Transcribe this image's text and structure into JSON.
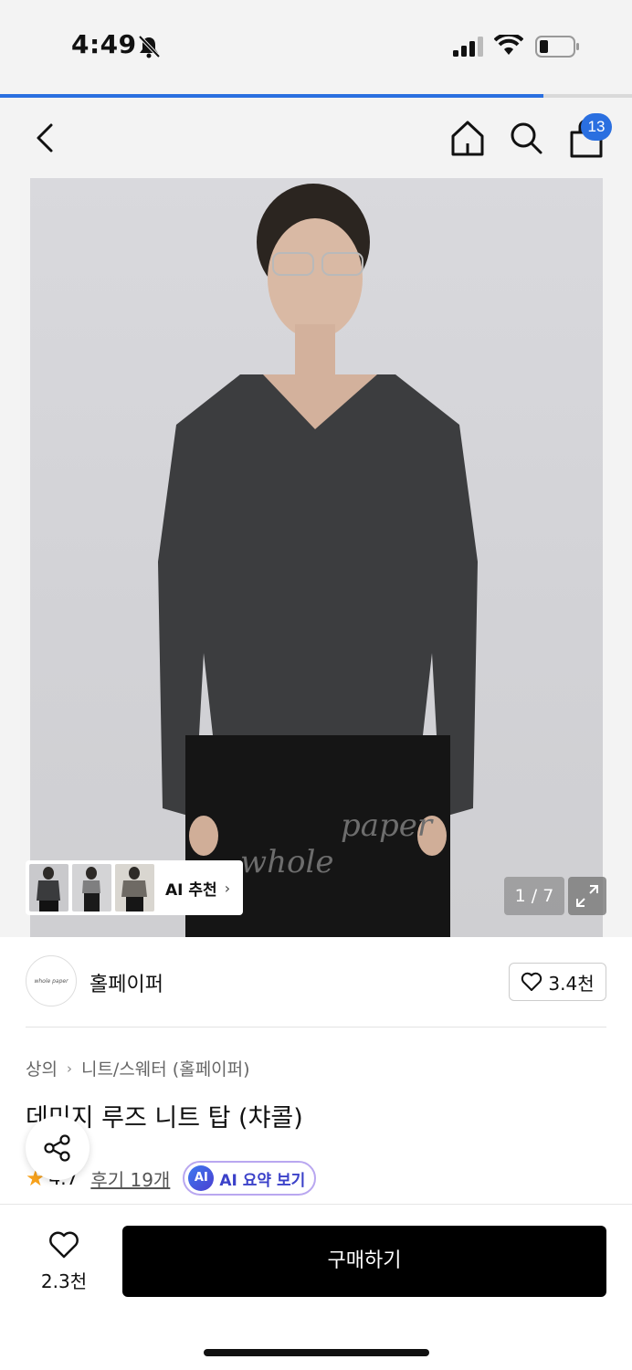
{
  "status_bar": {
    "time": "4:49",
    "icons": [
      "bell-off-icon",
      "signal-icon",
      "wifi-icon",
      "battery-icon"
    ]
  },
  "page_progress": {
    "fraction": 0.86,
    "color": "#2a6fe0"
  },
  "nav": {
    "cart_badge": "13",
    "icons": [
      "back-chevron-icon",
      "home-icon",
      "search-icon",
      "shopping-bag-icon"
    ]
  },
  "hero": {
    "thumb_strip_label": "AI 추천",
    "counter": "1 / 7",
    "icons": [
      "chevron-right-icon",
      "expand-icon"
    ]
  },
  "brand": {
    "name": "홀페이퍼",
    "likes": "3.4천"
  },
  "breadcrumb": {
    "category": "상의",
    "subcategory": "니트/스웨터 (홀페이퍼)"
  },
  "product": {
    "title": "데미지 루즈 니트 탑 (챠콜)"
  },
  "rating": {
    "value": "4.7",
    "reviews": "후기 19개",
    "ai_chip": "AI",
    "ai_summary": "AI 요약 보기"
  },
  "bottom": {
    "wish_count": "2.3천",
    "buy_label": "구매하기"
  },
  "colors": {
    "accent": "#2a6fe0",
    "buy_button": "#000000",
    "star": "#f7a11b",
    "ai_text": "#3b41c9"
  }
}
